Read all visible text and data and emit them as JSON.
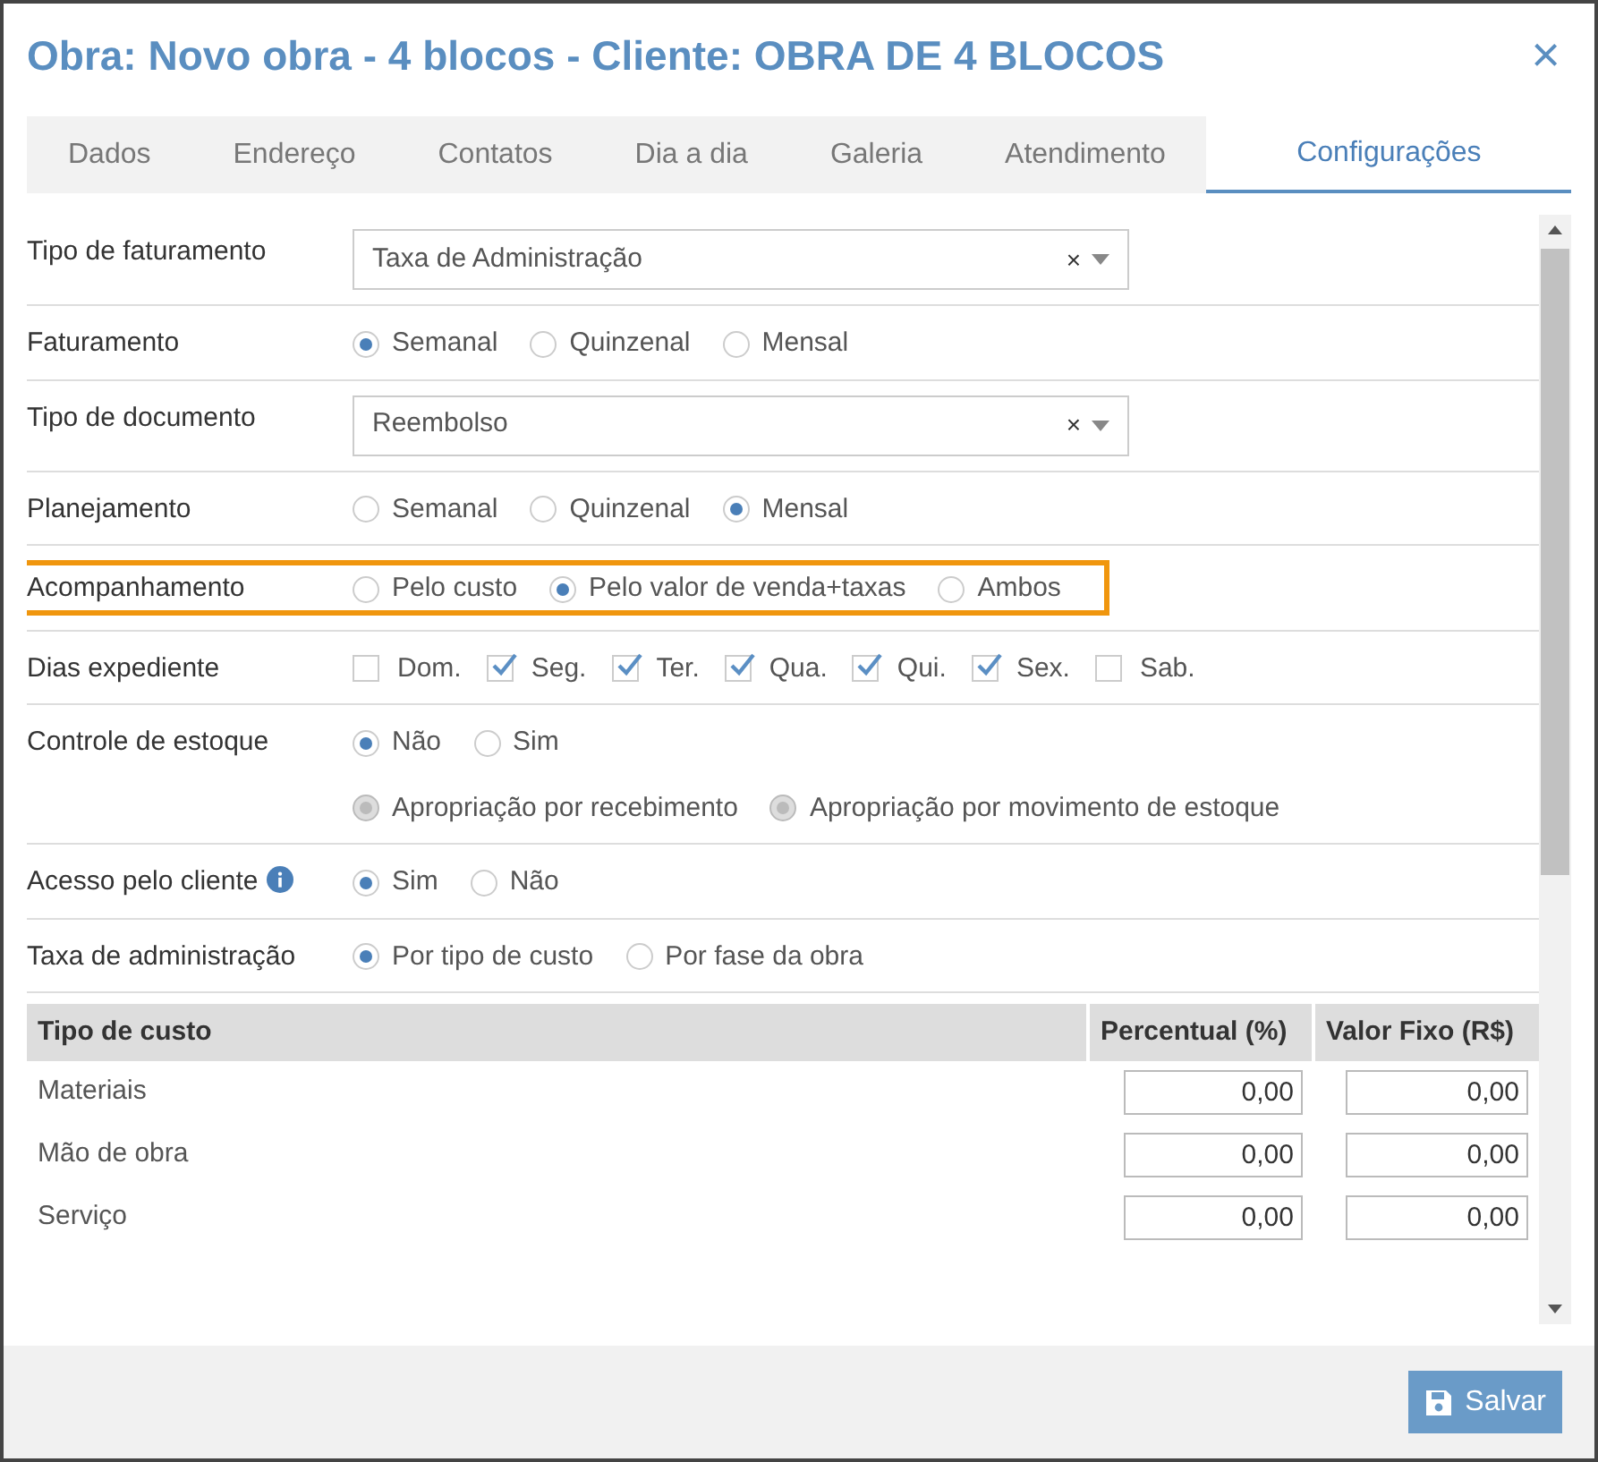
{
  "window": {
    "title": "Obra: Novo obra - 4 blocos - Cliente: OBRA DE 4 BLOCOS",
    "close": "×"
  },
  "tabs": [
    {
      "label": "Dados",
      "selected": false
    },
    {
      "label": "Endereço",
      "selected": false
    },
    {
      "label": "Contatos",
      "selected": false
    },
    {
      "label": "Dia a dia",
      "selected": false
    },
    {
      "label": "Galeria",
      "selected": false
    },
    {
      "label": "Atendimento",
      "selected": false
    },
    {
      "label": "Configurações",
      "selected": true
    }
  ],
  "fields": [
    {
      "kind": "select",
      "label": "Tipo de faturamento",
      "value": "Taxa de Administração",
      "clear": "×",
      "highlighted": false
    },
    {
      "kind": "radio",
      "label": "Faturamento",
      "highlighted": false,
      "option_rows": [
        [
          {
            "label": "Semanal",
            "selected": true,
            "disabled": false
          },
          {
            "label": "Quinzenal",
            "selected": false,
            "disabled": false
          },
          {
            "label": "Mensal",
            "selected": false,
            "disabled": false
          }
        ]
      ]
    },
    {
      "kind": "select",
      "label": "Tipo de documento",
      "value": "Reembolso",
      "clear": "×",
      "highlighted": false
    },
    {
      "kind": "radio",
      "label": "Planejamento",
      "highlighted": false,
      "option_rows": [
        [
          {
            "label": "Semanal",
            "selected": false,
            "disabled": false
          },
          {
            "label": "Quinzenal",
            "selected": false,
            "disabled": false
          },
          {
            "label": "Mensal",
            "selected": true,
            "disabled": false
          }
        ]
      ]
    },
    {
      "kind": "radio",
      "label": "Acompanhamento",
      "highlighted": true,
      "option_rows": [
        [
          {
            "label": "Pelo custo",
            "selected": false,
            "disabled": false
          },
          {
            "label": "Pelo valor de venda+taxas",
            "selected": true,
            "disabled": false
          },
          {
            "label": "Ambos",
            "selected": false,
            "disabled": false
          }
        ]
      ]
    },
    {
      "kind": "checkbox",
      "label": "Dias expediente",
      "highlighted": false,
      "options": [
        {
          "label": "Dom.",
          "checked": false
        },
        {
          "label": "Seg.",
          "checked": true
        },
        {
          "label": "Ter.",
          "checked": true
        },
        {
          "label": "Qua.",
          "checked": true
        },
        {
          "label": "Qui.",
          "checked": true
        },
        {
          "label": "Sex.",
          "checked": true
        },
        {
          "label": "Sab.",
          "checked": false
        }
      ]
    },
    {
      "kind": "radio",
      "label": "Controle de estoque",
      "highlighted": false,
      "option_rows": [
        [
          {
            "label": "Não",
            "selected": true,
            "disabled": false
          },
          {
            "label": "Sim",
            "selected": false,
            "disabled": false
          }
        ],
        [
          {
            "label": "Apropriação por recebimento",
            "selected": false,
            "disabled": true
          },
          {
            "label": "Apropriação por movimento de estoque",
            "selected": false,
            "disabled": true
          }
        ]
      ]
    },
    {
      "kind": "radio",
      "label": "Acesso pelo cliente",
      "info": true,
      "highlighted": false,
      "option_rows": [
        [
          {
            "label": "Sim",
            "selected": true,
            "disabled": false
          },
          {
            "label": "Não",
            "selected": false,
            "disabled": false
          }
        ]
      ]
    },
    {
      "kind": "radio",
      "label": "Taxa de administração",
      "highlighted": false,
      "option_rows": [
        [
          {
            "label": "Por tipo de custo",
            "selected": true,
            "disabled": false
          },
          {
            "label": "Por fase da obra",
            "selected": false,
            "disabled": false
          }
        ]
      ]
    }
  ],
  "table": {
    "columns": [
      "Tipo de custo",
      "Percentual (%)",
      "Valor Fixo (R$)"
    ],
    "rows": [
      {
        "name": "Materiais",
        "percentual": "0,00",
        "valor_fixo": "0,00"
      },
      {
        "name": "Mão de obra",
        "percentual": "0,00",
        "valor_fixo": "0,00"
      },
      {
        "name": "Serviço",
        "percentual": "0,00",
        "valor_fixo": "0,00"
      }
    ]
  },
  "footer": {
    "save": "Salvar"
  }
}
